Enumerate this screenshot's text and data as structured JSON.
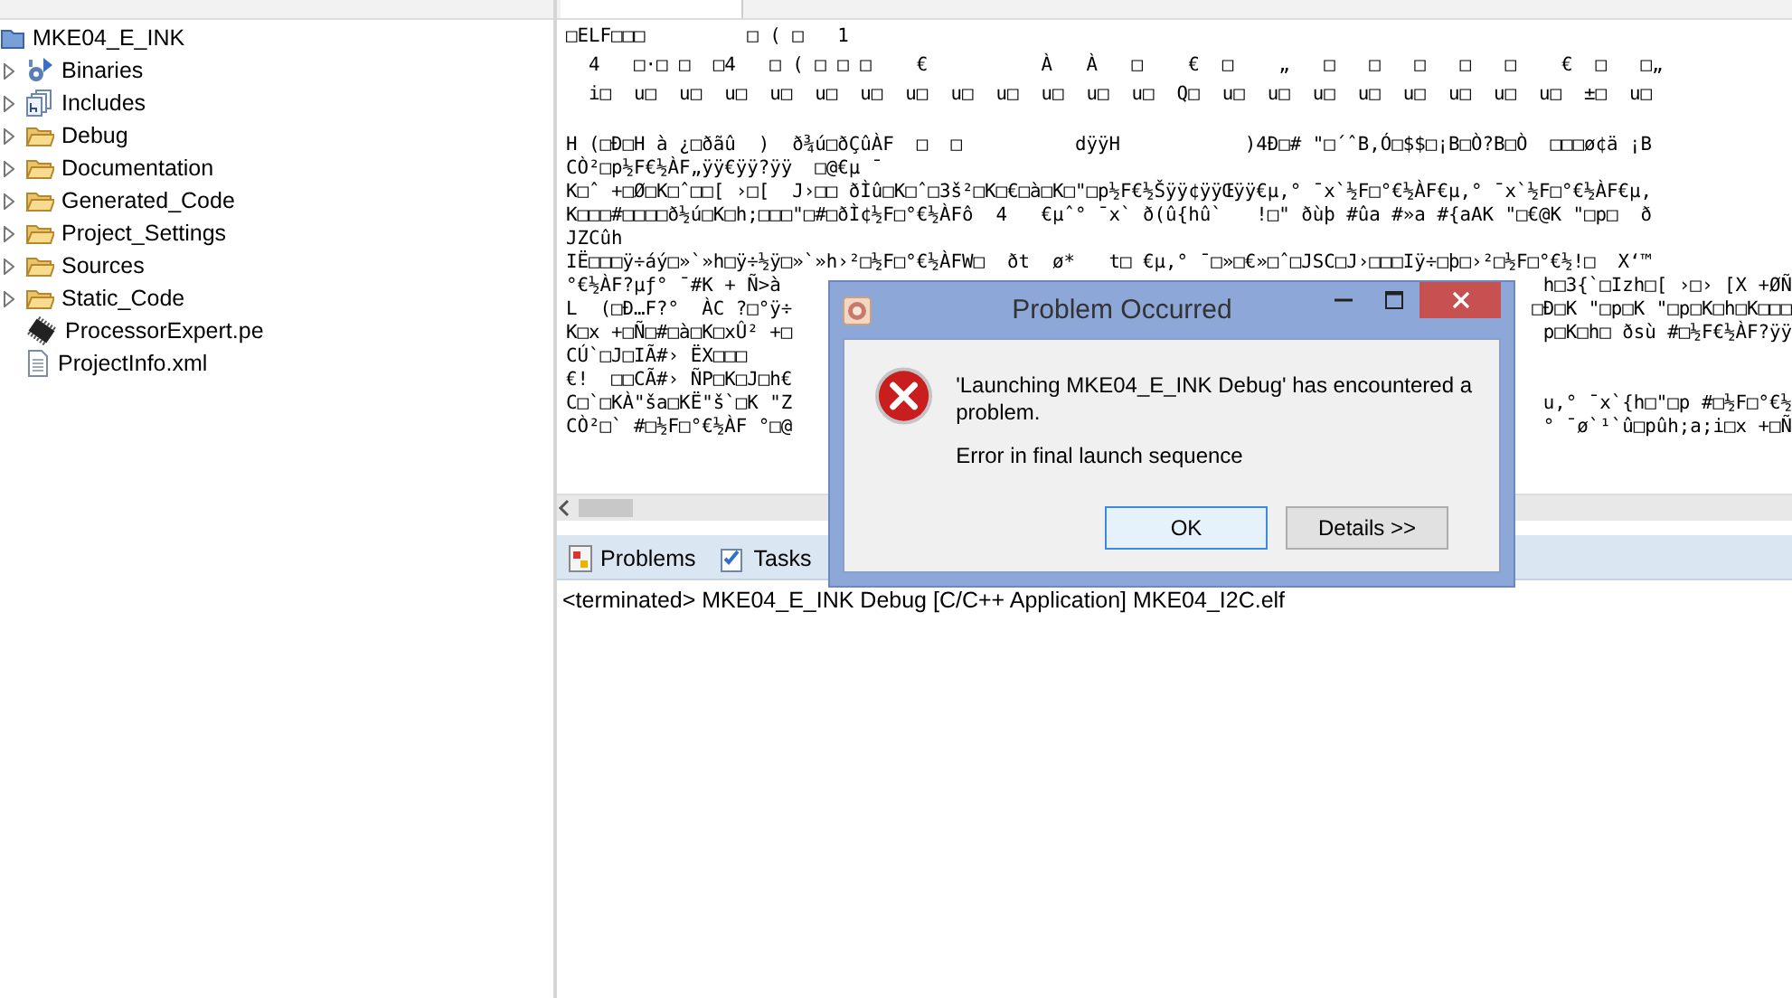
{
  "explorer": {
    "project": "MKE04_E_INK",
    "items": [
      {
        "label": "Binaries",
        "kind": "binaries",
        "expandable": true
      },
      {
        "label": "Includes",
        "kind": "includes",
        "expandable": true
      },
      {
        "label": "Debug",
        "kind": "folder",
        "expandable": true
      },
      {
        "label": "Documentation",
        "kind": "folder",
        "expandable": true
      },
      {
        "label": "Generated_Code",
        "kind": "folder",
        "expandable": true
      },
      {
        "label": "Project_Settings",
        "kind": "folder",
        "expandable": true
      },
      {
        "label": "Sources",
        "kind": "folder",
        "expandable": true
      },
      {
        "label": "Static_Code",
        "kind": "folder",
        "expandable": true
      },
      {
        "label": "ProcessorExpert.pe",
        "kind": "chip",
        "expandable": false
      },
      {
        "label": "ProjectInfo.xml",
        "kind": "file",
        "expandable": false
      }
    ]
  },
  "editor": {
    "blocks": [
      {
        "lines": [
          {
            "text": "□ELF□□□         □ ( □   1"
          },
          {
            "text": "  4   □·□ □  □4   □ ( □ □ □    €          À   À   □    €  □    „   □   □   □   □   □    €  □   □„"
          },
          {
            "text": "  i□  u□  u□  u□  u□  u□  u□  u□  u□  u□  u□  u□  u□  Q□  u□  u□  u□  u□  u□  u□  u□  u□  ±□  u□"
          }
        ]
      },
      {
        "lines": [
          {
            "text": "H (□Ð□H à ¿□ðãû  )  ð¾ú□ðÇûÀF  □  □          dÿÿH           )4Ð□# \"□´ˆB,Ó□$$□¡B□Ò?B□Ò  □□□ø¢ä ¡B"
          },
          {
            "text": "CÒ²□p½F€½ÀF„ÿÿ€ÿÿ?ÿÿ  □@€µ ¯"
          },
          {
            "text": "K□ˆ +□Ø□K□ˆ□□[ ›□[  J›□□ ðÌû□K□ˆ□3š²□K□€□à□K□\"□p½F€½Šÿÿ¢ÿÿŒÿÿ€µ,° ¯x`½F□°€½ÀF€µ,° ¯x`½F□°€½ÀF€µ,"
          },
          {
            "text": "K□□□#□□□□ð½ú□K□h;□□□\"□#□ðÌ¢½F□°€½ÀFô  4   €µˆ° ¯x` ð(û{hû`   !□\" ðùþ #ûa #»a #{aAK \"□€@K \"□p□  ð"
          },
          {
            "text": "JZCûh"
          },
          {
            "text": "IË□□□ÿ÷áý□»`»h□ÿ÷½ÿ□»`»h›²□½F□°€½ÀFW□  ðt  ø*   t□ €µ,° ¯□»□€»□ˆ□JSC□J›□□□Iÿ÷□þ□›²□½F□°€½!□  X‘™"
          },
          {
            "left": "°€½ÀF?µƒ° ¯#K + Ñ>à",
            "right": "h□3{`□Izh□[ ›□› [X +ØÑ"
          },
          {
            "left": "L  (□Ð…F?°  ÀC ?□°ÿ÷",
            "right": "□Ð□K \"□p□K \"□p□K□h□K□□□"
          },
          {
            "left": "K□x +□Ñ□#□à□K□xÛ² +□",
            "right": "p□K□h□ ðsù #□½F€½ÀF?ÿÿ"
          },
          {
            "left": "CÚ`□J□IÃ#› ËX□□□"
          },
          {
            "left": "€!  □□CÃ#› ÑP□K□J□h€"
          },
          {
            "left": "C□`□KÀ\"ša□KË\"š`□K \"Z",
            "right": "u,° ¯x`{h□\"□p #□½F□°€½"
          },
          {
            "left": "CÒ²□` #□½F□°€½ÀF °□@",
            "right": "° ¯ø`¹`û□pûh;a;i□x +□Ñ"
          }
        ]
      }
    ]
  },
  "bottom": {
    "tabs": [
      {
        "label": "Problems",
        "kind": "problems",
        "selected": false
      },
      {
        "label": "Tasks",
        "kind": "tasks",
        "selected": false
      }
    ],
    "console": "<terminated> MKE04_E_INK Debug [C/C++ Application] MKE04_I2C.elf"
  },
  "dialog": {
    "title": "Problem Occurred",
    "message": "'Launching MKE04_E_INK Debug' has encountered a problem.",
    "detail": "Error in final launch sequence",
    "buttons": [
      {
        "label": "OK",
        "default": true
      },
      {
        "label": "Details >>",
        "default": false
      }
    ]
  }
}
